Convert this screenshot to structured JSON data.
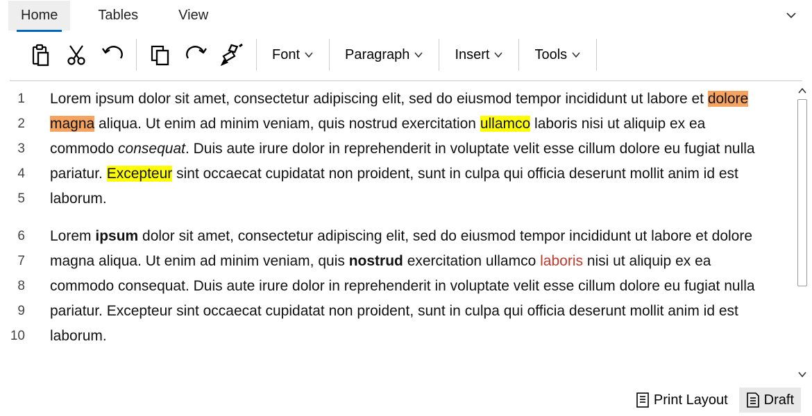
{
  "tabs": {
    "home": "Home",
    "tables": "Tables",
    "view": "View"
  },
  "toolbar": {
    "font": "Font",
    "paragraph": "Paragraph",
    "insert": "Insert",
    "tools": "Tools"
  },
  "body": {
    "p1": {
      "t1": "Lorem ipsum dolor sit amet, consectetur adipiscing elit, sed do eiusmod tempor incididunt ut labore et ",
      "hl_orange": "dolore magna",
      "t2": " aliqua. Ut enim ad minim veniam, quis nostrud exercitation ",
      "hl_yellow1": "ullamco",
      "t3": " laboris nisi ut aliquip ex ea commodo ",
      "italic": "consequat",
      "t4": ". Duis aute irure dolor in reprehenderit in voluptate velit esse cillum dolore eu fugiat nulla pariatur. ",
      "hl_yellow2": "Excepteur",
      "t5": " sint occaecat cupidatat non proident, sunt in culpa qui officia deserunt mollit anim id est laborum."
    },
    "p2": {
      "t1": "Lorem ",
      "bold1": "ipsum",
      "t2": " dolor sit amet, consectetur adipiscing elit, sed do eiusmod tempor incididunt ut labore et dolore magna aliqua. Ut enim ad minim veniam, quis ",
      "bold2": "nostrud",
      "t3": " exercitation ullamco ",
      "red": "laboris",
      "t4": " nisi ut aliquip ex ea commodo consequat. Duis aute irure dolor in reprehenderit in voluptate velit esse cillum dolore eu fugiat nulla pariatur. Excepteur sint occaecat cupidatat non proident, sunt in culpa qui officia deserunt mollit anim id est laborum."
    }
  },
  "lines": [
    "1",
    "2",
    "3",
    "4",
    "5",
    "6",
    "7",
    "8",
    "9",
    "10"
  ],
  "footer": {
    "print_layout": "Print Layout",
    "draft": "Draft"
  }
}
